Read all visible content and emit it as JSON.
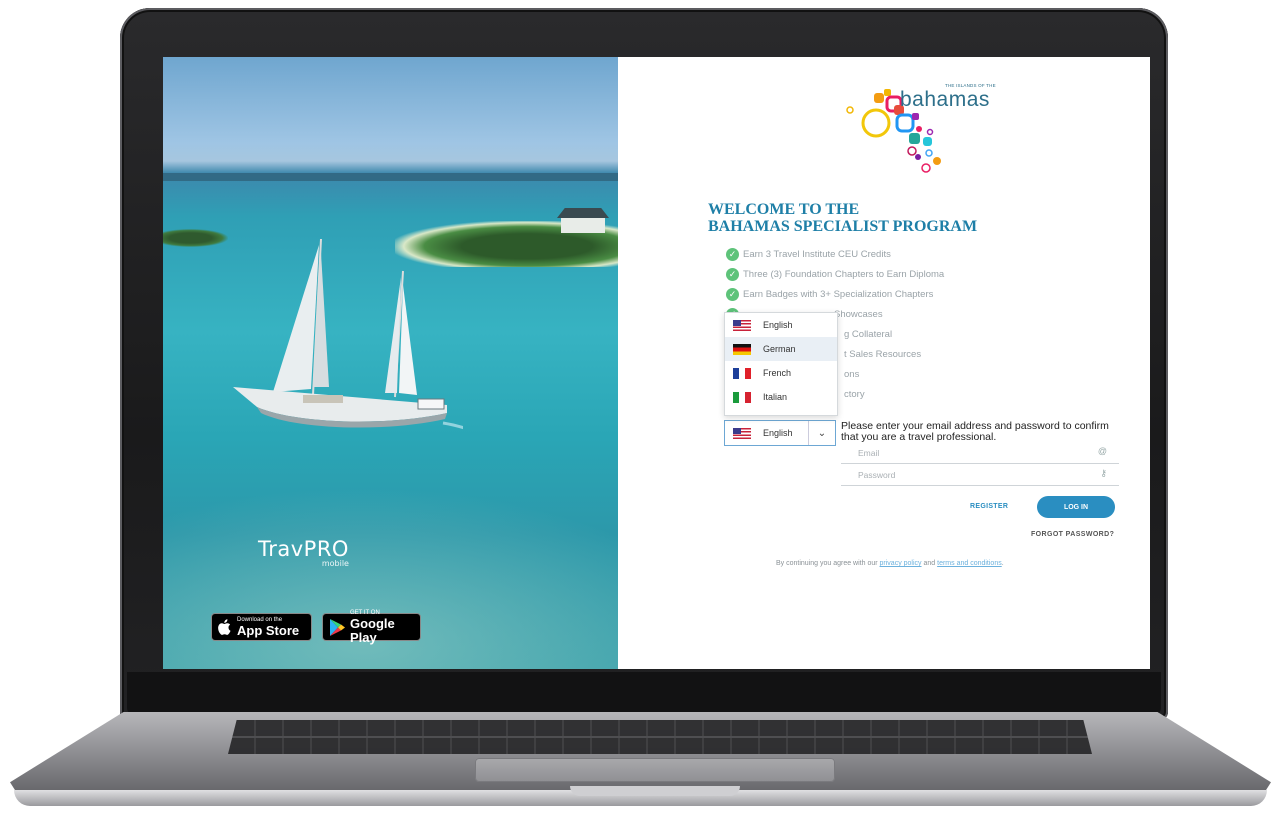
{
  "left_panel": {
    "brand": "TravPRO",
    "brand_sub": "mobile",
    "app_store": {
      "small": "Download on the",
      "big": "App Store"
    },
    "google_play": {
      "small": "GET IT ON",
      "big": "Google Play"
    }
  },
  "logo": {
    "small_text": "THE ISLANDS OF THE",
    "main_text": "bahamas"
  },
  "welcome": {
    "line1": "WELCOME TO THE",
    "line2": "BAHAMAS SPECIALIST PROGRAM"
  },
  "features": [
    "Earn 3 Travel Institute CEU Credits",
    "Three (3) Foundation Chapters to Earn Diploma",
    "Earn Badges with 3+ Specialization Chapters",
    "Showcases",
    "g Collateral",
    "t Sales Resources",
    "ons",
    "ctory"
  ],
  "language": {
    "selected": "English",
    "options": [
      "English",
      "German",
      "French",
      "Italian"
    ],
    "highlighted": "German"
  },
  "login": {
    "instructions": "Please enter your email address and password to confirm that you are a travel professional.",
    "email_placeholder": "Email",
    "password_placeholder": "Password",
    "register_label": "REGISTER",
    "login_label": "LOG IN",
    "forgot_label": "FORGOT PASSWORD?"
  },
  "terms": {
    "prefix": "By continuing you agree with our",
    "privacy": "privacy policy",
    "and": "and",
    "tos": "terms and conditions",
    "suffix": "."
  },
  "colors": {
    "accent": "#2a8ec1",
    "heading": "#1e7fa7",
    "check": "#5ec37a"
  }
}
